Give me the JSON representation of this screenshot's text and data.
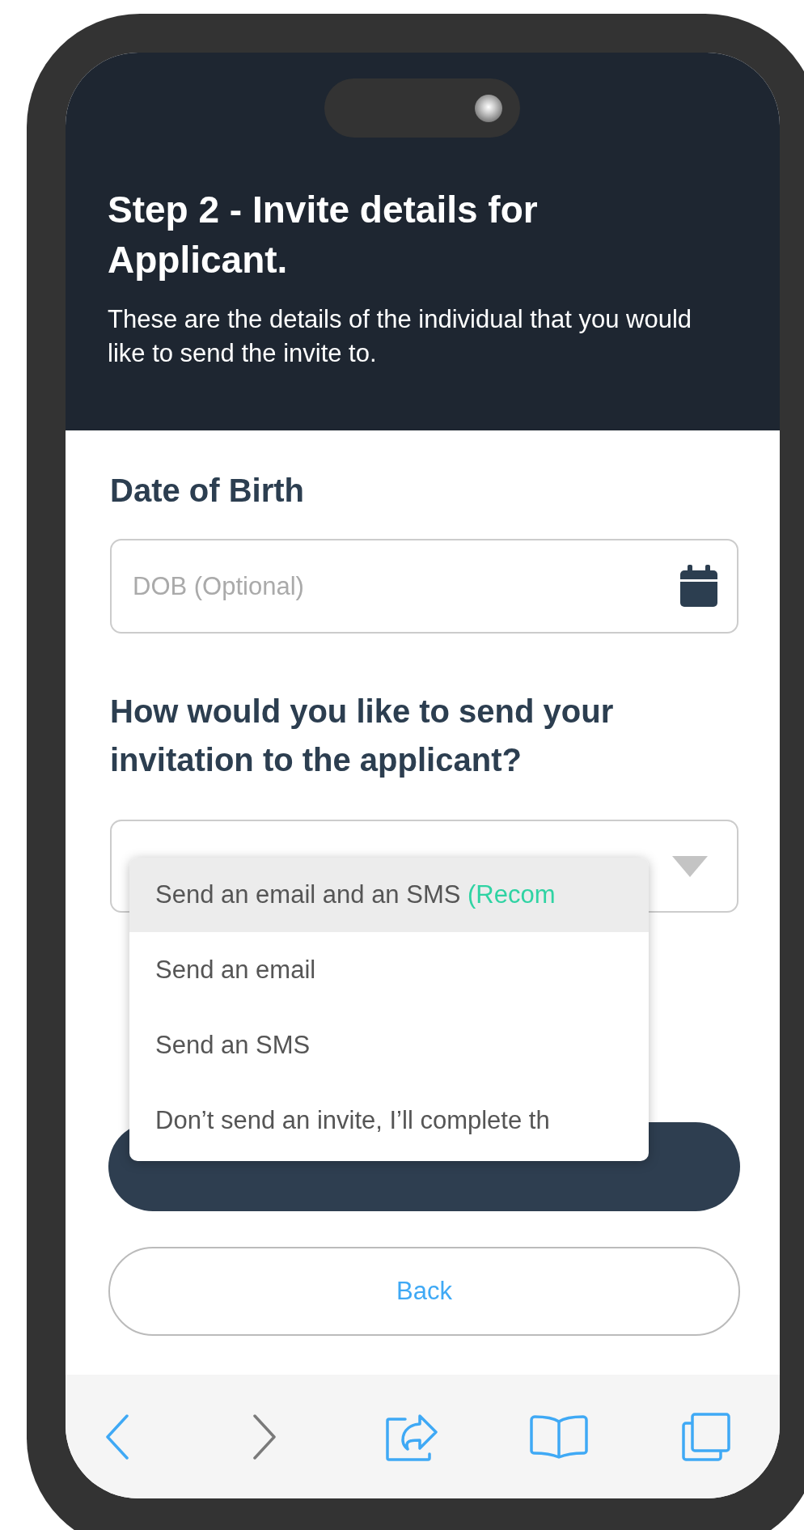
{
  "header": {
    "title": "Step 2 - Invite details for Applicant.",
    "subtitle": "These are the details of the individual that you would like to send the invite to."
  },
  "dob": {
    "label": "Date of Birth",
    "placeholder": "DOB (Optional)"
  },
  "send_method": {
    "question": "How would you like to send your invitation to the applicant?",
    "expanded": true,
    "options": [
      {
        "label": "Send an email and an SMS ",
        "note": "(Recom",
        "selected": true
      },
      {
        "label": "Send an email",
        "selected": false
      },
      {
        "label": "Send an SMS",
        "selected": false
      },
      {
        "label": "Don’t send an invite, I’ll complete th",
        "selected": false
      }
    ]
  },
  "buttons": [
    {
      "kind": "primary"
    },
    {
      "kind": "secondary",
      "label": "Back"
    }
  ],
  "toolbar": [
    {
      "kind": "back",
      "disabled": false
    },
    {
      "kind": "forward",
      "disabled": true
    },
    {
      "kind": "share",
      "disabled": false
    },
    {
      "kind": "bookmarks",
      "disabled": false
    },
    {
      "kind": "tabs",
      "disabled": false
    }
  ]
}
